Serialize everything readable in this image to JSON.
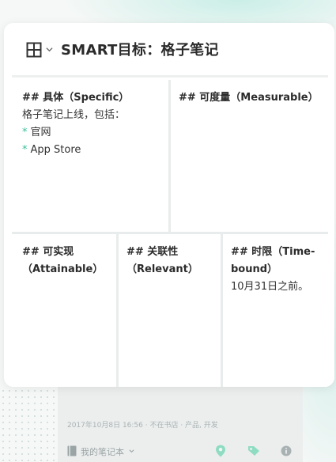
{
  "note": {
    "title": "SMART目标：格子笔记",
    "cells": {
      "specific": {
        "heading": "## 具体（Specific）",
        "line1": "格子笔记上线，包括：",
        "bullet_marker": "*",
        "item1": "官网",
        "item2": "App Store"
      },
      "measurable": {
        "heading": "## 可度量（Measurable）"
      },
      "attainable": {
        "heading_line1": "## 可实现",
        "heading_line2": "（Attainable）"
      },
      "relevant": {
        "heading_line1": "## 关联性",
        "heading_line2": "（Relevant）"
      },
      "timebound": {
        "heading_line1": "## 时限（Time-",
        "heading_line2": "bound）",
        "line1": "10月31日之前。"
      }
    }
  },
  "footer": {
    "meta": "2017年10月8日 16:56 · 不在书店 · 产品, 开发",
    "notebook_label": "我的笔记本"
  },
  "icons": {
    "layout": "grid-layout-icon",
    "location": "location-pin-icon",
    "tag": "tag-icon",
    "info": "info-icon"
  },
  "colors": {
    "accent": "#3cbf9a",
    "footer_icon": "#8fdcc3"
  }
}
